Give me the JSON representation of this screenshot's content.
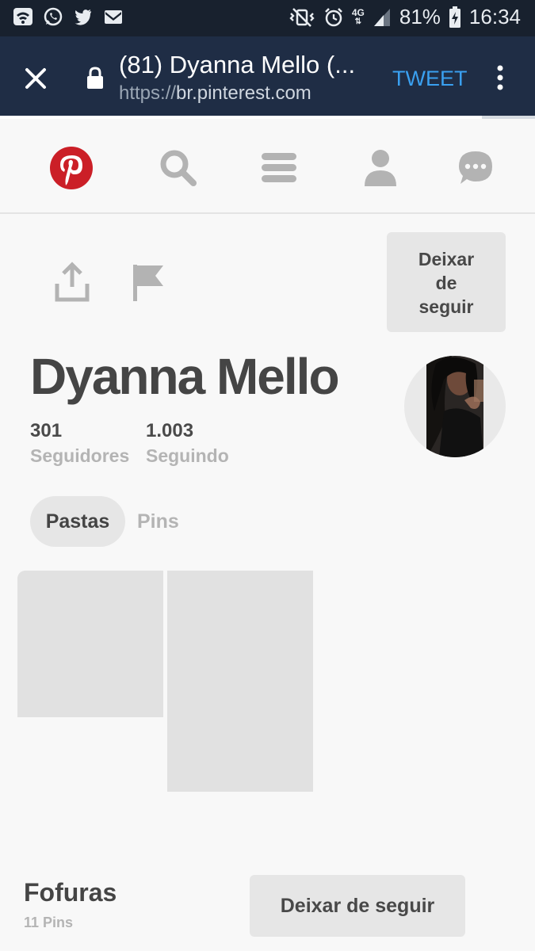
{
  "status_bar": {
    "icons_left": [
      "wifi-icon",
      "whatsapp-icon",
      "twitter-icon",
      "gmail-icon"
    ],
    "icons_right": [
      "vibrate-mute-icon",
      "alarm-icon",
      "4g-signal-icon",
      "battery-charging-icon"
    ],
    "network": "4G",
    "battery": "81%",
    "time": "16:34"
  },
  "browser": {
    "page_title": "(81) Dyanna Mello (...",
    "url_scheme": "https://",
    "url_host": "br.pinterest.com",
    "action_label": "TWEET",
    "load_progress": 0.9,
    "colors": {
      "action": "#3aa0f0",
      "header": "#1f2d45",
      "statusbar": "#18212e"
    }
  },
  "nav": {
    "items": [
      "pinterest-logo-icon",
      "search-icon",
      "menu-icon",
      "profile-icon",
      "messages-icon"
    ],
    "brand_color": "#cb1f27"
  },
  "profile": {
    "name": "Dyanna Mello",
    "unfollow_label_top": [
      "Deixar",
      "de",
      "seguir"
    ],
    "followers_count": "301",
    "followers_label": "Seguidores",
    "following_count": "1.003",
    "following_label": "Seguindo"
  },
  "tabs": {
    "boards_label": "Pastas",
    "pins_label": "Pins",
    "active": "Pastas"
  },
  "board": {
    "title": "Fofuras",
    "pin_count": "11 Pins",
    "unfollow_label": "Deixar de seguir"
  }
}
